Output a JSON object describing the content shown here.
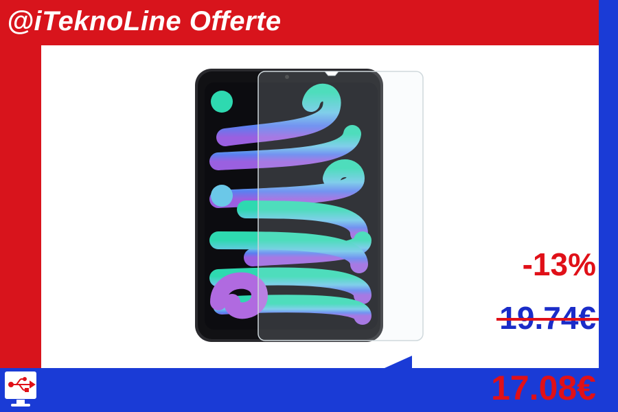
{
  "header": {
    "brand": "@iTeknoLine Offerte"
  },
  "product": {
    "image": "ipad-mini-tempered-glass-screen-protector"
  },
  "pricing": {
    "discount": "-13%",
    "old_price": "19.74€",
    "new_price": "17.08€"
  },
  "colors": {
    "brand_red": "#d8141c",
    "brand_blue": "#1a3bd6",
    "price_red": "#e01018",
    "old_price_blue": "#1a2cc8"
  },
  "logo": {
    "icon": "usb-monitor-icon"
  }
}
